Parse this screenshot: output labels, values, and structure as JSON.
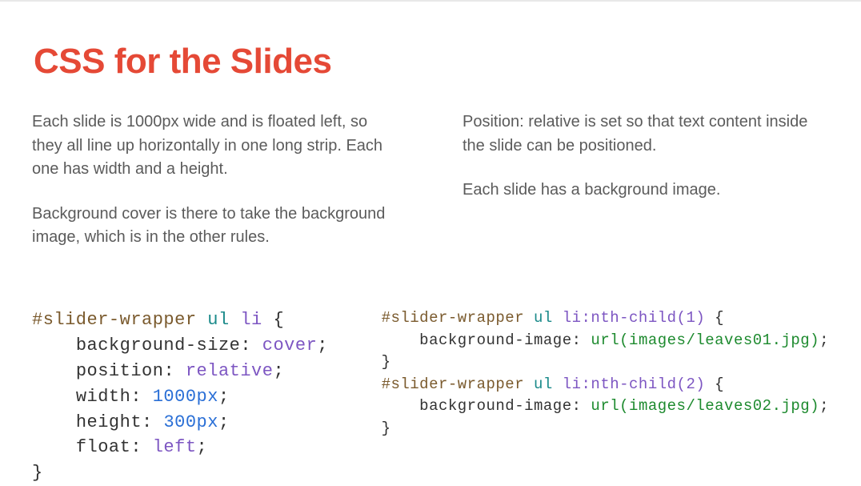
{
  "title": "CSS for the Slides",
  "leftColumn": {
    "p1": "Each slide is 1000px wide and is floated left, so they all line up horizontally in one long strip. Each one has width and a height.",
    "p2": "Background cover is there to take the background image, which is in the other rules."
  },
  "rightColumn": {
    "p1": "Position: relative is set so that text content inside the slide can be positioned.",
    "p2": "Each slide has a background image."
  },
  "code1": {
    "selector_part1": "#slider-wrapper",
    "selector_part2": "ul",
    "selector_part3": "li",
    "open": "{",
    "rule1_prop": "background-size",
    "rule1_val": "cover",
    "rule2_prop": "position",
    "rule2_val": "relative",
    "rule3_prop": "width",
    "rule3_val": "1000px",
    "rule4_prop": "height",
    "rule4_val": "300px",
    "rule5_prop": "float",
    "rule5_val": "left",
    "close": "}"
  },
  "code2": {
    "block1": {
      "selector_part1": "#slider-wrapper",
      "selector_part2": "ul",
      "selector_part3": "li:nth-child",
      "selector_arg": "(1)",
      "open": "{",
      "rule_prop": "background-image",
      "rule_val_fn": "url",
      "rule_val_arg": "(images/leaves01.jpg)",
      "close": "}"
    },
    "block2": {
      "selector_part1": "#slider-wrapper",
      "selector_part2": "ul",
      "selector_part3": "li:nth-child",
      "selector_arg": "(2)",
      "open": "{",
      "rule_prop": "background-image",
      "rule_val_fn": "url",
      "rule_val_arg": "(images/leaves02.jpg)",
      "close": "}"
    }
  }
}
